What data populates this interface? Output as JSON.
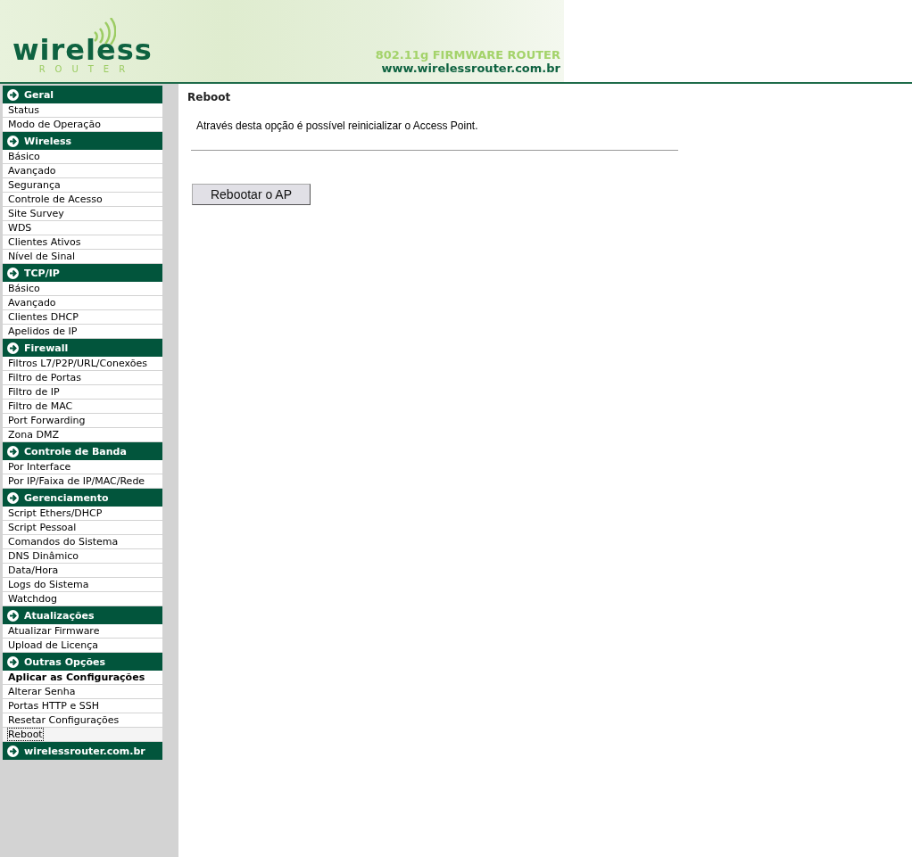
{
  "banner": {
    "logo_word": "wireless",
    "logo_subword": "ROUTER",
    "tagline": "802.11g FIRMWARE ROUTER",
    "url": "www.wirelessrouter.com.br"
  },
  "sidebar": {
    "sections": [
      {
        "title": "Geral",
        "items": [
          {
            "label": "Status",
            "bold": false,
            "selected": false
          },
          {
            "label": "Modo de Operação",
            "bold": false,
            "selected": false
          }
        ]
      },
      {
        "title": "Wireless",
        "items": [
          {
            "label": "Básico",
            "bold": false,
            "selected": false
          },
          {
            "label": "Avançado",
            "bold": false,
            "selected": false
          },
          {
            "label": "Segurança",
            "bold": false,
            "selected": false
          },
          {
            "label": "Controle de Acesso",
            "bold": false,
            "selected": false
          },
          {
            "label": "Site Survey",
            "bold": false,
            "selected": false
          },
          {
            "label": "WDS",
            "bold": false,
            "selected": false
          },
          {
            "label": "Clientes Ativos",
            "bold": false,
            "selected": false
          },
          {
            "label": "Nível de Sinal",
            "bold": false,
            "selected": false
          }
        ]
      },
      {
        "title": "TCP/IP",
        "items": [
          {
            "label": "Básico",
            "bold": false,
            "selected": false
          },
          {
            "label": "Avançado",
            "bold": false,
            "selected": false
          },
          {
            "label": "Clientes DHCP",
            "bold": false,
            "selected": false
          },
          {
            "label": "Apelidos de IP",
            "bold": false,
            "selected": false
          }
        ]
      },
      {
        "title": "Firewall",
        "items": [
          {
            "label": "Filtros L7/P2P/URL/Conexões",
            "bold": false,
            "selected": false
          },
          {
            "label": "Filtro de Portas",
            "bold": false,
            "selected": false
          },
          {
            "label": "Filtro de IP",
            "bold": false,
            "selected": false
          },
          {
            "label": "Filtro de MAC",
            "bold": false,
            "selected": false
          },
          {
            "label": "Port Forwarding",
            "bold": false,
            "selected": false
          },
          {
            "label": "Zona DMZ",
            "bold": false,
            "selected": false
          }
        ]
      },
      {
        "title": "Controle de Banda",
        "items": [
          {
            "label": "Por Interface",
            "bold": false,
            "selected": false
          },
          {
            "label": "Por IP/Faixa de IP/MAC/Rede",
            "bold": false,
            "selected": false
          }
        ]
      },
      {
        "title": "Gerenciamento",
        "items": [
          {
            "label": "Script Ethers/DHCP",
            "bold": false,
            "selected": false
          },
          {
            "label": "Script Pessoal",
            "bold": false,
            "selected": false
          },
          {
            "label": "Comandos do Sistema",
            "bold": false,
            "selected": false
          },
          {
            "label": "DNS Dinâmico",
            "bold": false,
            "selected": false
          },
          {
            "label": "Data/Hora",
            "bold": false,
            "selected": false
          },
          {
            "label": "Logs do Sistema",
            "bold": false,
            "selected": false
          },
          {
            "label": "Watchdog",
            "bold": false,
            "selected": false
          }
        ]
      },
      {
        "title": "Atualizações",
        "items": [
          {
            "label": "Atualizar Firmware",
            "bold": false,
            "selected": false
          },
          {
            "label": "Upload de Licença",
            "bold": false,
            "selected": false
          }
        ]
      },
      {
        "title": "Outras Opções",
        "items": [
          {
            "label": "Aplicar as Configurações",
            "bold": true,
            "selected": false
          },
          {
            "label": "Alterar Senha",
            "bold": false,
            "selected": false
          },
          {
            "label": "Portas HTTP e SSH",
            "bold": false,
            "selected": false
          },
          {
            "label": "Resetar Configurações",
            "bold": false,
            "selected": false
          },
          {
            "label": "Reboot",
            "bold": false,
            "selected": true
          }
        ]
      },
      {
        "title": "wirelessrouter.com.br"
      }
    ]
  },
  "content": {
    "title": "Reboot",
    "description": "Através desta opção é possível reinicializar o Access Point.",
    "button": "Rebootar o AP"
  }
}
